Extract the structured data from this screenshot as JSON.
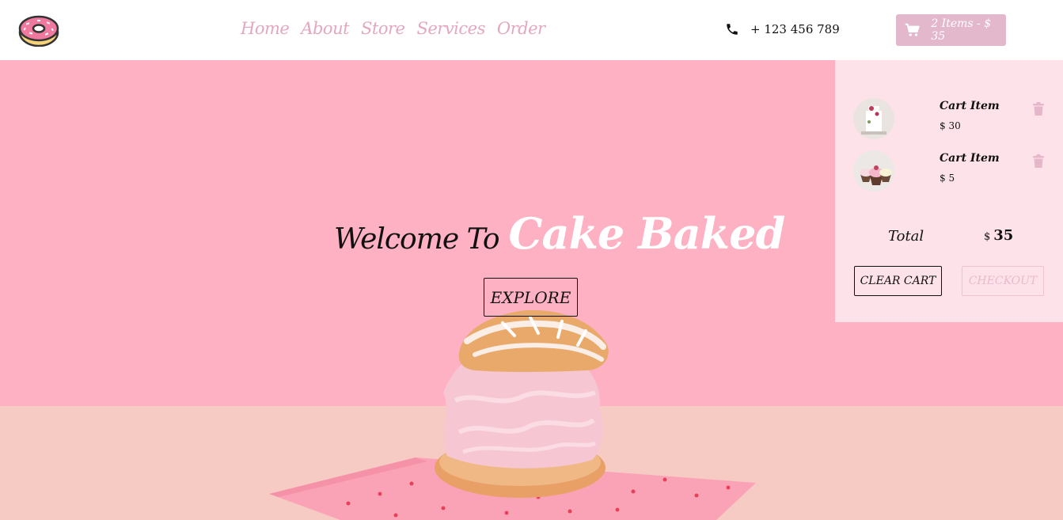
{
  "brand": {
    "logo": "donut-icon"
  },
  "nav": {
    "links": [
      "Home",
      "About",
      "Store",
      "Services",
      "Order"
    ]
  },
  "phone": {
    "icon": "phone-icon",
    "number": "+ 123 456 789"
  },
  "cart_button": {
    "icon": "shopping-cart-icon",
    "label": "2 Items - $ 35"
  },
  "hero": {
    "welcome": "Welcome To",
    "brand": "Cake Baked",
    "explore_label": "EXPLORE"
  },
  "cart": {
    "items": [
      {
        "name": "Cart Item",
        "price": "$ 30",
        "image": "cake-thumbnail"
      },
      {
        "name": "Cart Item",
        "price": "$ 5",
        "image": "cupcake-thumbnail"
      }
    ],
    "total_label": "Total",
    "total_currency": "$",
    "total_value": "35",
    "clear_label": "CLEAR CART",
    "checkout_label": "CHECKOUT"
  },
  "colors": {
    "accent": "#e3b8cc",
    "nav_link": "#e3a7c0",
    "hero_wall": "#fdb1c3",
    "hero_table": "#f6cbc4",
    "cart_panel": "#fde3e9"
  }
}
